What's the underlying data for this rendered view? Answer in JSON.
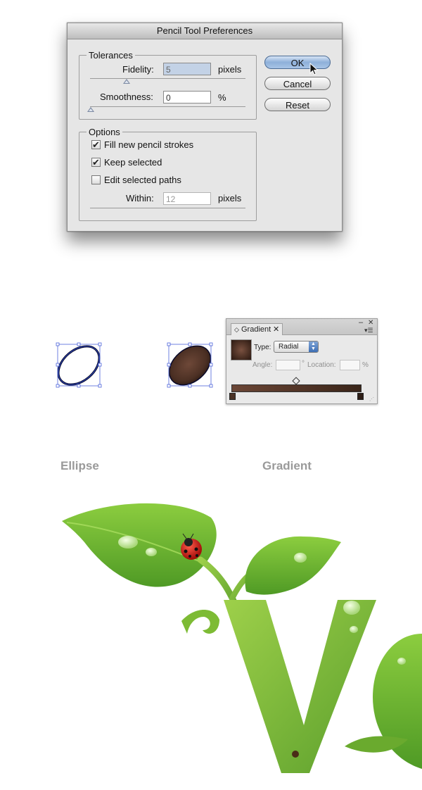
{
  "dialog": {
    "title": "Pencil Tool Preferences",
    "tolerances": {
      "legend": "Tolerances",
      "fidelity": {
        "label": "Fidelity:",
        "value": "5",
        "unit": "pixels",
        "level": 0.2
      },
      "smoothness": {
        "label": "Smoothness:",
        "value": "0",
        "unit": "%",
        "level": 0.0
      }
    },
    "options": {
      "legend": "Options",
      "fill_new_strokes": {
        "label": "Fill new pencil strokes",
        "checked": true
      },
      "keep_selected": {
        "label": "Keep selected",
        "checked": true
      },
      "edit_selected_paths": {
        "label": "Edit selected paths",
        "checked": false
      },
      "within": {
        "label": "Within:",
        "value": "12",
        "unit": "pixels"
      }
    },
    "buttons": {
      "ok": "OK",
      "cancel": "Cancel",
      "reset": "Reset"
    }
  },
  "gradient_panel": {
    "tab_label": "Gradient",
    "type_label": "Type:",
    "type_value": "Radial",
    "angle_label": "Angle:",
    "angle_unit": "°",
    "location_label": "Location:",
    "location_unit": "%",
    "colors": {
      "start": "#4a3226",
      "mid": "#6b4636",
      "end": "#2e1e16"
    }
  },
  "captions": {
    "ellipse": "Ellipse",
    "gradient": "Gradient"
  }
}
